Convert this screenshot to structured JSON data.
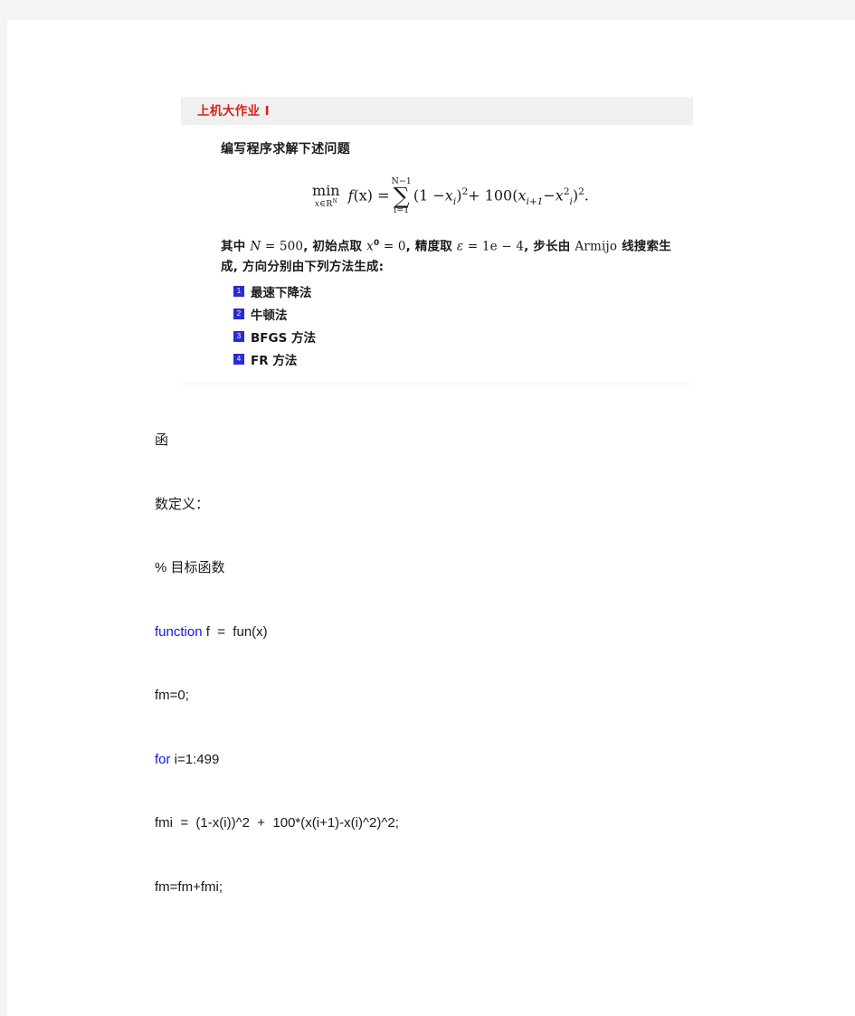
{
  "document": {
    "title": "上机大作业 I"
  },
  "problem_card": {
    "header_title": "上机大作业 I",
    "prompt": "编写程序求解下述问题",
    "formula": {
      "min_op": "min",
      "min_sub_x": "x",
      "min_sub_in": "∈",
      "min_sub_space": "R",
      "min_sub_sup": "N",
      "fx": "f",
      "fx_arg": "(x) =",
      "sum_upper": "N−1",
      "sum_symbol": "∑",
      "sum_lower": "i=1",
      "body_a": "(1 −",
      "body_xi": "x",
      "body_xi_sub": "i",
      "body_a2": ")",
      "body_sq1": "2",
      "body_plus": "+ 100(",
      "body_xi1": "x",
      "body_xi1_sub": "i+1",
      "body_minus": "−",
      "body_xi2": "x",
      "body_xi2_sub": "i",
      "body_xi2_sup": "2",
      "body_close": ")",
      "body_sq2": "2",
      "body_period": ".",
      "plain": "min_{x∈R^N} f(x) = Σ_{i=1}^{N−1} (1 − x_i)^2 + 100(x_{i+1} − x_i^2)^2."
    },
    "params": {
      "seg1": "其中 ",
      "math_N": "N",
      "eq_N": " = 500",
      "seg2": ", 初始点取 ",
      "math_x0": "x",
      "math_x0_sup": "0",
      "eq_x0": " = 0",
      "seg3": ", 精度取 ",
      "math_eps": "ε",
      "eq_eps": " = 1e − 4",
      "seg4": ", 步长由 ",
      "word_armijo": "Armijo",
      "seg5": " 线搜索生成, 方向分别由下列方法生成:"
    },
    "methods": [
      {
        "num": "1",
        "label": "最速下降法"
      },
      {
        "num": "2",
        "label": "牛顿法"
      },
      {
        "num": "3",
        "label": "BFGS 方法"
      },
      {
        "num": "4",
        "label": "FR 方法"
      }
    ]
  },
  "body": {
    "lines": [
      {
        "text": "函",
        "keyword": ""
      },
      {
        "text": "数定义：",
        "keyword": ""
      },
      {
        "text": "% 目标函数",
        "keyword": ""
      },
      {
        "text": " f  =  fun(x)",
        "keyword": "function"
      },
      {
        "text": "fm=0;",
        "keyword": ""
      },
      {
        "text": " i=1:499",
        "keyword": "for"
      },
      {
        "text": "fmi  =  (1-x(i))^2  +  100*(x(i+1)-x(i)^2)^2;",
        "keyword": ""
      },
      {
        "text": "fm=fm+fmi;",
        "keyword": ""
      }
    ]
  },
  "colors": {
    "page_background": "#ffffff",
    "outer_background": "#f4f4f4",
    "header_bar": "#f0f0f0",
    "title_red": "#d92118",
    "badge_blue": "#2b2bd4",
    "keyword_blue": "#1414e6",
    "text_black": "#1a1a1a"
  }
}
